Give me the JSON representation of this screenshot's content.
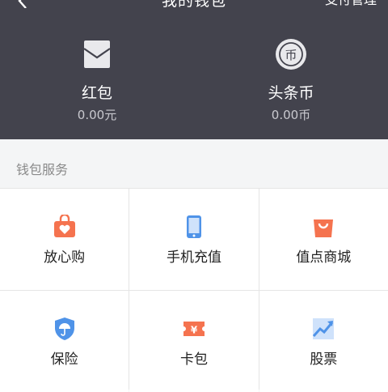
{
  "nav": {
    "title": "我的钱包",
    "action": "支付管理"
  },
  "wallet": {
    "items": [
      {
        "name": "红包",
        "amount": "0.00元",
        "icon": "envelope-icon"
      },
      {
        "name": "头条币",
        "amount": "0.00币",
        "icon": "coin-icon",
        "glyph": "币"
      }
    ]
  },
  "services": {
    "section_title": "钱包服务",
    "items": [
      {
        "label": "放心购",
        "icon": "heart-bag-icon",
        "color": "#f5734f"
      },
      {
        "label": "手机充值",
        "icon": "phone-icon",
        "color": "#4f93e8"
      },
      {
        "label": "值点商城",
        "icon": "shopping-bag-icon",
        "color": "#f5734f"
      },
      {
        "label": "保险",
        "icon": "umbrella-shield-icon",
        "color": "#4f93e8"
      },
      {
        "label": "卡包",
        "icon": "ticket-icon",
        "color": "#f5734f",
        "glyph": "¥"
      },
      {
        "label": "股票",
        "icon": "stock-chart-icon",
        "color": "#4f93e8"
      }
    ]
  }
}
